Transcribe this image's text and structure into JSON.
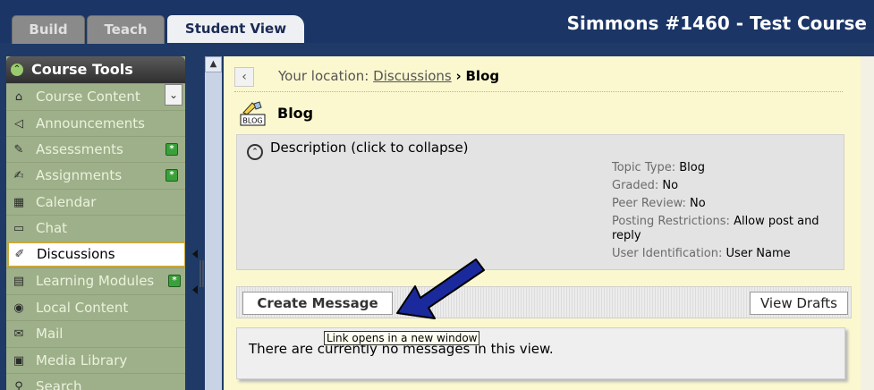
{
  "header": {
    "tabs": [
      {
        "label": "Build"
      },
      {
        "label": "Teach"
      },
      {
        "label": "Student View"
      }
    ],
    "course_title": "Simmons #1460 - Test Course"
  },
  "sidebar": {
    "title": "Course Tools",
    "items": [
      {
        "label": "Course Content",
        "icon": "home-icon"
      },
      {
        "label": "Announcements",
        "icon": "megaphone-icon"
      },
      {
        "label": "Assessments",
        "icon": "assessment-icon"
      },
      {
        "label": "Assignments",
        "icon": "assignment-icon"
      },
      {
        "label": "Calendar",
        "icon": "calendar-icon"
      },
      {
        "label": "Chat",
        "icon": "chat-icon"
      },
      {
        "label": "Discussions",
        "icon": "discussion-icon"
      },
      {
        "label": "Learning Modules",
        "icon": "modules-icon"
      },
      {
        "label": "Local Content",
        "icon": "local-content-icon"
      },
      {
        "label": "Mail",
        "icon": "mail-icon"
      },
      {
        "label": "Media Library",
        "icon": "media-icon"
      },
      {
        "label": "Search",
        "icon": "search-icon"
      }
    ]
  },
  "location": {
    "prefix": "Your location:",
    "link": "Discussions",
    "separator": "›",
    "current": "Blog"
  },
  "topic": {
    "icon_label": "BLOG",
    "title": "Blog",
    "toggle": "Description (click to collapse)",
    "meta": [
      {
        "key": "Topic Type:",
        "value": "Blog"
      },
      {
        "key": "Graded:",
        "value": "No"
      },
      {
        "key": "Peer Review:",
        "value": "No"
      },
      {
        "key": "Posting Restrictions:",
        "value": "Allow post and reply"
      },
      {
        "key": "User Identification:",
        "value": "User Name"
      }
    ]
  },
  "actions": {
    "create": "Create Message",
    "drafts": "View Drafts"
  },
  "messages": {
    "empty": "There are currently no messages in this view.",
    "tooltip": "Link opens in a new window"
  },
  "colors": {
    "header_bg": "#1b3566",
    "sidebar_bg": "#9eb08a",
    "content_bg": "#fbf8cf",
    "arrow": "#1c2b9e"
  }
}
